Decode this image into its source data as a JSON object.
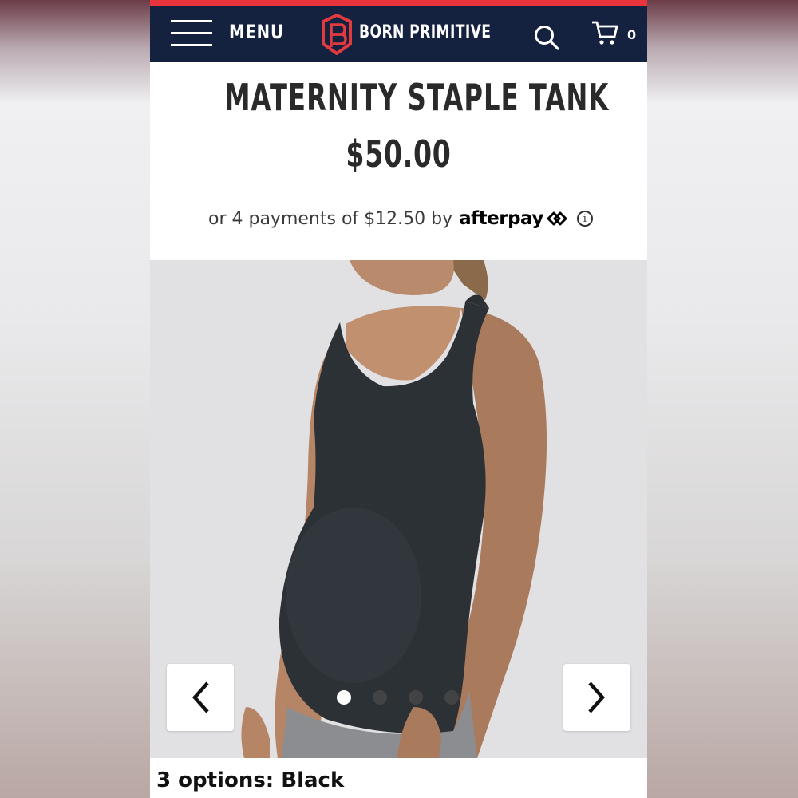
{
  "header": {
    "menu_label": "MENU",
    "brand_name": "BORN PRIMITIVE",
    "cart_count": "0",
    "icons": [
      "hamburger-menu-icon",
      "brand-logo-icon",
      "search-icon",
      "cart-icon"
    ],
    "colors": {
      "nav_bg": "#14213f",
      "accent_strip": "#e8343a",
      "logo_red": "#e23a3f"
    }
  },
  "product": {
    "title": "MATERNITY STAPLE TANK",
    "price": "$50.00",
    "installment_text": "or 4 payments of $12.50 by",
    "installment_provider": "afterpay",
    "info_glyph": "i"
  },
  "carousel": {
    "prev_glyph": "❮",
    "next_glyph": "❯",
    "slide_count": 4,
    "active_index": 0
  },
  "options": {
    "label": "3 options: Black"
  }
}
